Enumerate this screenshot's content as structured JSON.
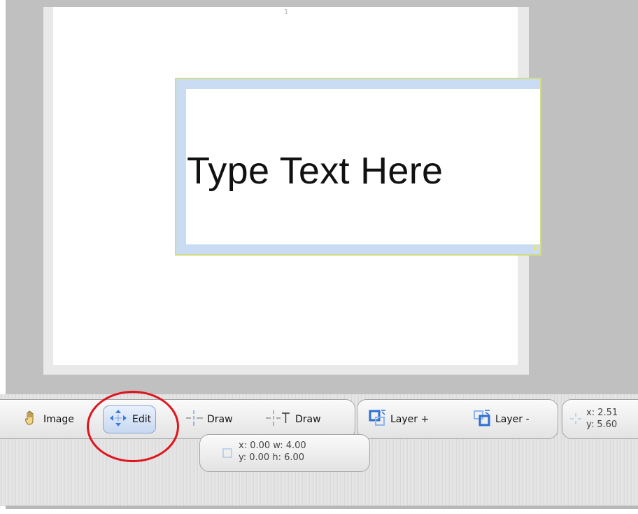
{
  "canvas": {
    "page_marker": "1",
    "textbox": {
      "text": "Type Text Here",
      "handle_label": "2"
    }
  },
  "toolbar": {
    "image_label": "Image",
    "edit_label": "Edit",
    "draw_label": "Draw",
    "text_draw_label": "Draw",
    "layer_up_label": "Layer +",
    "layer_down_label": "Layer -",
    "cursor_x": "x: 2.51",
    "cursor_y": "y: 5.60"
  },
  "selection": {
    "line1": "x: 0.00 w: 4.00",
    "line2": "y: 0.00 h: 6.00"
  },
  "colors": {
    "workspace": "#c0c0c0",
    "textbox_border": "#d2dc82",
    "textbox_margin": "#c9dcf4",
    "annotation": "#e0141c",
    "active_button": "#c8d8f1"
  },
  "icons": [
    "hand-icon",
    "move-arrows-icon",
    "draw-line-icon",
    "text-draw-icon",
    "layer-up-icon",
    "layer-down-icon",
    "crosshair-icon",
    "selection-box-icon"
  ]
}
